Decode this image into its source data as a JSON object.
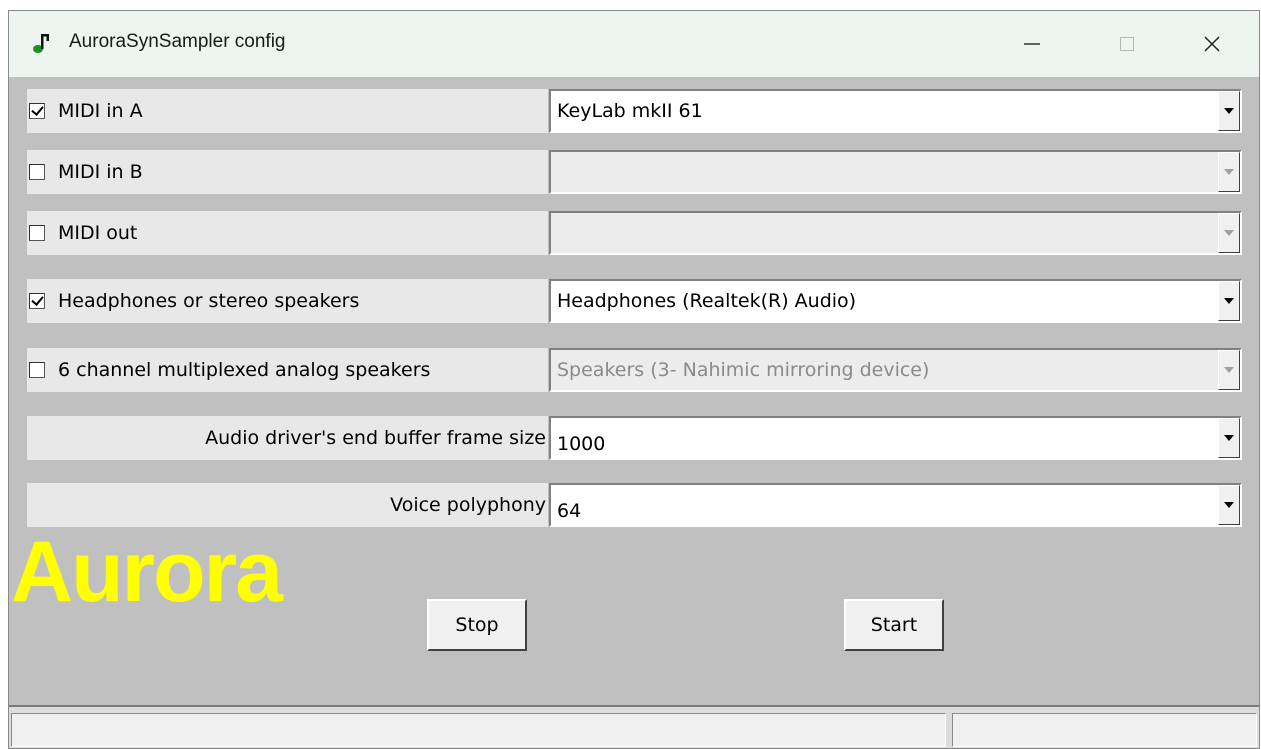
{
  "window": {
    "title": "AuroraSynSampler config",
    "icon": "music-note-icon",
    "minimize_icon": "minimize-icon",
    "maximize_icon": "maximize-icon",
    "close_icon": "close-icon"
  },
  "rows": [
    {
      "label": "MIDI in A",
      "checked": true,
      "value": "KeyLab mkII 61",
      "enabled": true
    },
    {
      "label": "MIDI in B",
      "checked": false,
      "value": "",
      "enabled": false
    },
    {
      "label": "MIDI out",
      "checked": false,
      "value": "",
      "enabled": false
    },
    {
      "label": "Headphones or stereo speakers",
      "checked": true,
      "value": "Headphones (Realtek(R) Audio)",
      "enabled": true
    },
    {
      "label": "6 channel multiplexed analog speakers",
      "checked": false,
      "value": "Speakers (3- Nahimic mirroring device)",
      "enabled": false
    },
    {
      "label": "Audio driver's end buffer frame size",
      "value": "1000",
      "enabled": true
    },
    {
      "label": "Voice polyphony",
      "value": "64",
      "enabled": true
    }
  ],
  "logo": {
    "text": "Aurora",
    "color": "#ffff00"
  },
  "buttons": {
    "stop": "Stop",
    "start": "Start"
  },
  "statusbar": {
    "left": "",
    "right": ""
  }
}
